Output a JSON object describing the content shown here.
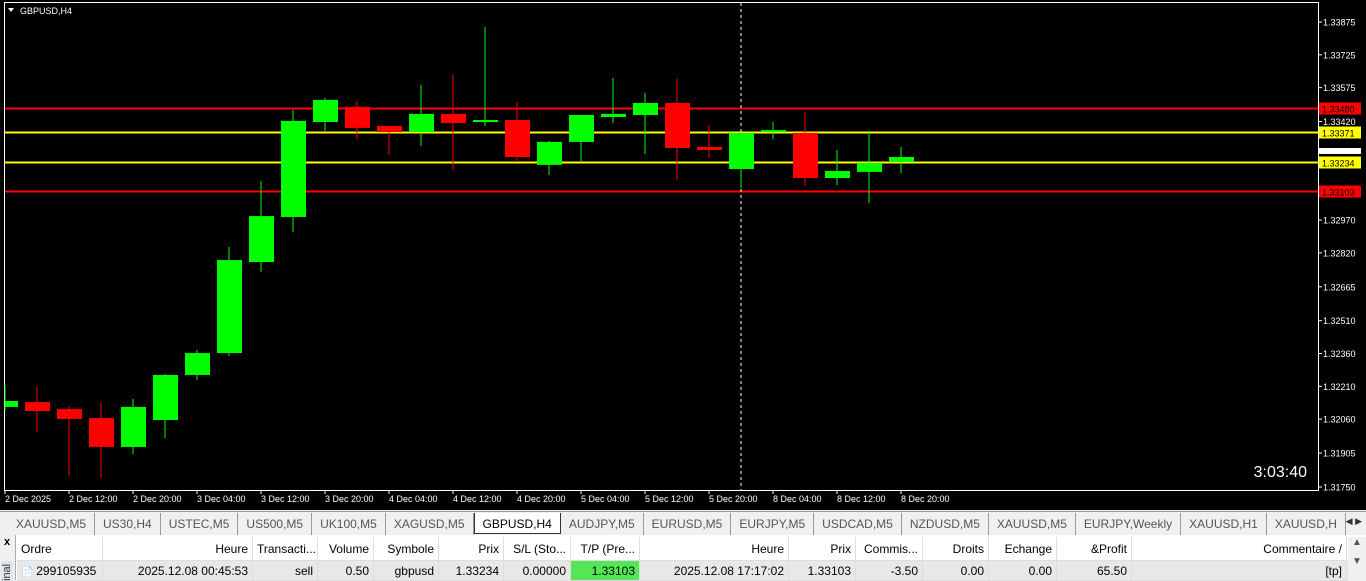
{
  "chart": {
    "title": "GBPUSD,H4",
    "timer": "3:03:40",
    "colors": {
      "bull": "#00ff00",
      "bear": "#ff0000",
      "background": "#000000",
      "resistance": "#ff0000",
      "support": "#ffff00"
    },
    "price_axis": [
      "1.33875",
      "1.33725",
      "1.33575",
      "1.33420",
      "1.32970",
      "1.32820",
      "1.32665",
      "1.32510",
      "1.32360",
      "1.32210",
      "1.32060",
      "1.31905",
      "1.31750"
    ],
    "time_axis": [
      "2 Dec 2025",
      "2 Dec 12:00",
      "2 Dec 20:00",
      "3 Dec 04:00",
      "3 Dec 12:00",
      "3 Dec 20:00",
      "4 Dec 04:00",
      "4 Dec 12:00",
      "4 Dec 20:00",
      "5 Dec 04:00",
      "5 Dec 12:00",
      "5 Dec 20:00",
      "8 Dec 04:00",
      "8 Dec 12:00",
      "8 Dec 20:00"
    ],
    "levels": [
      {
        "price": "1.33480",
        "color": "#ff0000"
      },
      {
        "price": "1.33371",
        "color": "#ffff00"
      },
      {
        "price": "1.33234",
        "color": "#ffff00"
      },
      {
        "price": "1.33103",
        "color": "#ff0000"
      }
    ],
    "candles": [
      [
        1.32116,
        1.32216,
        1.32102,
        1.32143
      ],
      [
        1.32138,
        1.32207,
        1.32001,
        1.32097
      ],
      [
        1.32106,
        1.3212,
        1.318,
        1.32061
      ],
      [
        1.32065,
        1.32134,
        1.31791,
        1.31933
      ],
      [
        1.31933,
        1.32152,
        1.31901,
        1.32116
      ],
      [
        1.32056,
        1.32266,
        1.31974,
        1.32262
      ],
      [
        1.32262,
        1.32376,
        1.32239,
        1.32362
      ],
      [
        1.32362,
        1.32847,
        1.32349,
        1.32787
      ],
      [
        1.32778,
        1.33148,
        1.32733,
        1.32988
      ],
      [
        1.32984,
        1.33473,
        1.32915,
        1.33423
      ],
      [
        1.33418,
        1.33528,
        1.33377,
        1.33519
      ],
      [
        1.33487,
        1.33514,
        1.3334,
        1.33391
      ],
      [
        1.334,
        1.334,
        1.33267,
        1.33372
      ],
      [
        1.33372,
        1.33587,
        1.33308,
        1.33455
      ],
      [
        1.33455,
        1.33633,
        1.33199,
        1.33413
      ],
      [
        1.33418,
        1.33852,
        1.334,
        1.33427
      ],
      [
        1.33427,
        1.33509,
        1.33235,
        1.33258
      ],
      [
        1.33222,
        1.33331,
        1.33176,
        1.33327
      ],
      [
        1.33327,
        1.3345,
        1.3324,
        1.3345
      ],
      [
        1.33441,
        1.33619,
        1.33413,
        1.33455
      ],
      [
        1.3345,
        1.33551,
        1.33272,
        1.33505
      ],
      [
        1.33505,
        1.33615,
        1.33153,
        1.33299
      ],
      [
        1.33304,
        1.33404,
        1.33254,
        1.3329
      ],
      [
        1.33203,
        1.33371,
        1.33116,
        1.33368
      ],
      [
        1.33381,
        1.33418,
        1.3334,
        1.33381
      ],
      [
        1.33368,
        1.33464,
        1.33126,
        1.33162
      ],
      [
        1.33162,
        1.3329,
        1.3313,
        1.33194
      ],
      [
        1.3319,
        1.33377,
        1.33048,
        1.33231
      ],
      [
        1.33235,
        1.33304,
        1.33185,
        1.33258
      ]
    ]
  },
  "tabs": [
    "XAUUSD,M5",
    "US30,H4",
    "USTEC,M5",
    "US500,M5",
    "UK100,M5",
    "XAGUSD,M5",
    "GBPUSD,H4",
    "AUDJPY,M5",
    "EURUSD,M5",
    "EURJPY,M5",
    "USDCAD,M5",
    "NZDUSD,M5",
    "XAUUSD,M5",
    "EURJPY,Weekly",
    "XAUUSD,H1",
    "XAUUSD,H"
  ],
  "active_tab": "GBPUSD,H4",
  "terminal": {
    "close": "x",
    "side_label": "inal",
    "columns": [
      "Ordre",
      "Heure",
      "Transacti...",
      "Volume",
      "Symbole",
      "Prix",
      "S/L (Sto...",
      "T/P (Pre...",
      "Heure",
      "Prix",
      "Commis...",
      "Droits",
      "Echange",
      "&Profit",
      "Commentaire  /"
    ],
    "row": [
      "299105935",
      "2025.12.08 00:45:53",
      "sell",
      "0.50",
      "gbpusd",
      "1.33234",
      "0.00000",
      "1.33103",
      "2025.12.08 17:17:02",
      "1.33103",
      "-3.50",
      "0.00",
      "0.00",
      "65.50",
      "[tp]"
    ]
  }
}
